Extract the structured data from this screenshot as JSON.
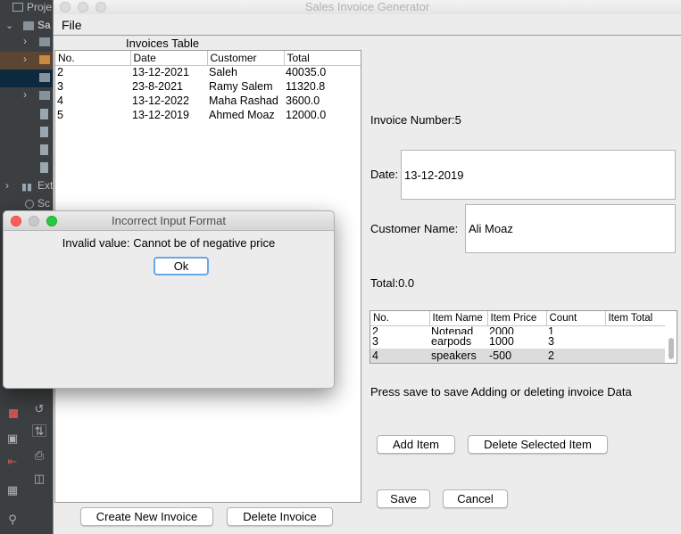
{
  "ide": {
    "rows": [
      "Proje",
      "Sa",
      "",
      "",
      "",
      "Ext",
      "Sc"
    ]
  },
  "window": {
    "title": "Sales Invoice Generator"
  },
  "menu": {
    "file": "File"
  },
  "invoices": {
    "label": "Invoices Table",
    "columns": [
      "No.",
      "Date",
      "Customer",
      "Total"
    ],
    "rows": [
      [
        "2",
        "13-12-2021",
        "Saleh",
        "40035.0"
      ],
      [
        "3",
        "23-8-2021",
        "Ramy Salem",
        "11320.8"
      ],
      [
        "4",
        "13-12-2022",
        "Maha Rashad",
        "3600.0"
      ],
      [
        "5",
        "13-12-2019",
        "Ahmed Moaz",
        "12000.0"
      ]
    ],
    "create_label": "Create New Invoice",
    "delete_label": "Delete Invoice"
  },
  "details": {
    "invoice_number": "Invoice Number:5",
    "date_label": "Date:",
    "date_value": "13-12-2019",
    "customer_label": "Customer Name:",
    "customer_value": "Ali Moaz",
    "total": "Total:0.0"
  },
  "items": {
    "columns": [
      "No.",
      "Item Name",
      "Item Price",
      "Count",
      "Item Total"
    ],
    "rows": [
      [
        "2",
        "Notepad",
        "2000",
        "1",
        ""
      ],
      [
        "3",
        "earpods",
        "1000",
        "3",
        ""
      ],
      [
        "4",
        "speakers",
        "-500",
        "2",
        ""
      ]
    ],
    "selected_row": 2
  },
  "hint": "Press save to save Adding or deleting invoice Data",
  "buttons": {
    "add_item": "Add Item",
    "delete_item": "Delete Selected Item",
    "save": "Save",
    "cancel": "Cancel"
  },
  "dialog": {
    "title": "Incorrect Input Format",
    "message": "Invalid value: Cannot be of negative price",
    "ok": "Ok"
  },
  "colors": {
    "close": "#ff5f57",
    "minimize": "#c8c8c8",
    "zoom": "#28c940",
    "focus_ring": "#6aa7e8",
    "selected_row": "#dcdcdc"
  }
}
